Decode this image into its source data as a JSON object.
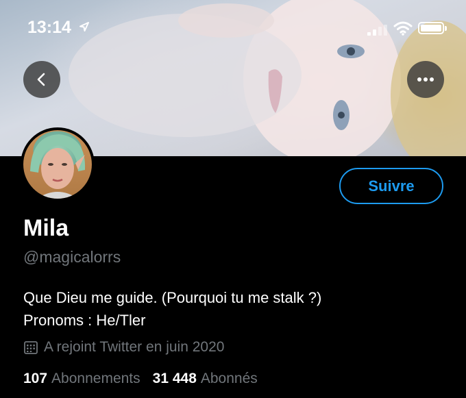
{
  "status_bar": {
    "time": "13:14",
    "icons": [
      "location-arrow-icon",
      "signal-icon",
      "wifi-icon",
      "battery-icon"
    ]
  },
  "header": {
    "back_icon": "chevron-left-icon",
    "more_icon": "more-horizontal-icon"
  },
  "profile": {
    "follow_label": "Suivre",
    "name": "Mila",
    "handle": "@magicalorrs",
    "bio_line1": "Que Dieu me guide. (Pourquoi tu me stalk ?)",
    "bio_line2": "Pronoms : He/Tler",
    "joined": "A rejoint Twitter en juin 2020",
    "following_count": "107",
    "following_label": "Abonnements",
    "followers_count": "31 448",
    "followers_label": "Abonnés"
  },
  "colors": {
    "accent": "#1d9bf0",
    "secondary_text": "#71767b",
    "background": "#000000"
  }
}
